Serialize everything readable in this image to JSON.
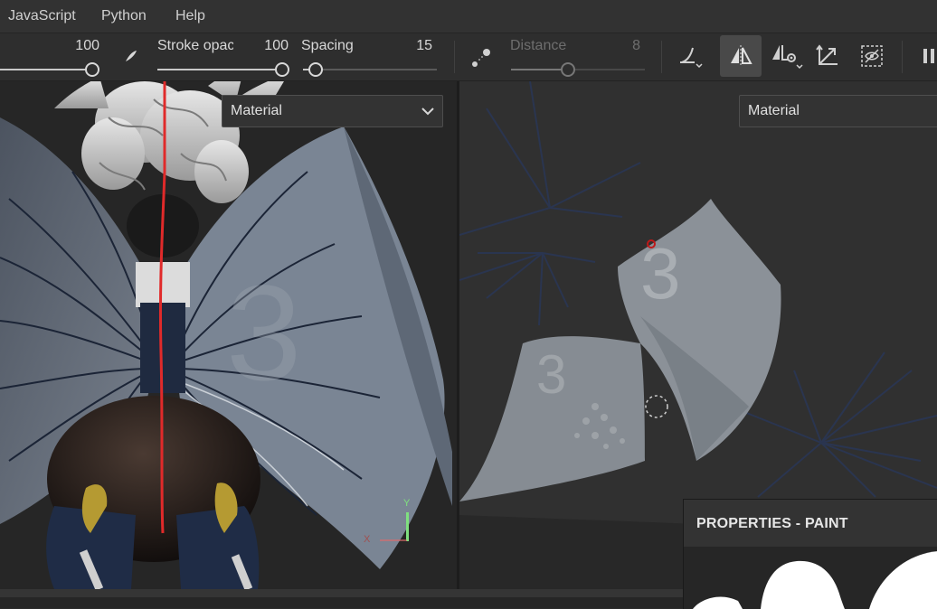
{
  "menu": {
    "items": [
      "JavaScript",
      "Python",
      "Help"
    ]
  },
  "toolbar": {
    "size": {
      "value": "100",
      "level": 1.0
    },
    "stroke_opacity": {
      "label": "Stroke opac",
      "value": "100",
      "level": 1.0
    },
    "spacing": {
      "label": "Spacing",
      "value": "15",
      "level": 0.05
    },
    "distance": {
      "label": "Distance",
      "value": "8",
      "level": 0.42,
      "enabled": false
    },
    "icons": [
      "brush-tip-icon",
      "lazy-mouse-icon",
      "stroke-curve-icon",
      "symmetry-icon",
      "symmetry-settings-icon",
      "transform-icon",
      "hide-unfocused-icon"
    ]
  },
  "viewport_3d": {
    "channel_select": "Material",
    "gizmo": {
      "x_label": "X",
      "y_label": "Y"
    }
  },
  "viewport_2d": {
    "channel_select": "Material"
  },
  "properties_panel": {
    "title": "PROPERTIES - PAINT"
  },
  "colors": {
    "symmetry_line": "#e02a2a",
    "gizmo_y": "#7fe07f",
    "gizmo_x": "#e06a6a",
    "active_button": "#494949"
  }
}
